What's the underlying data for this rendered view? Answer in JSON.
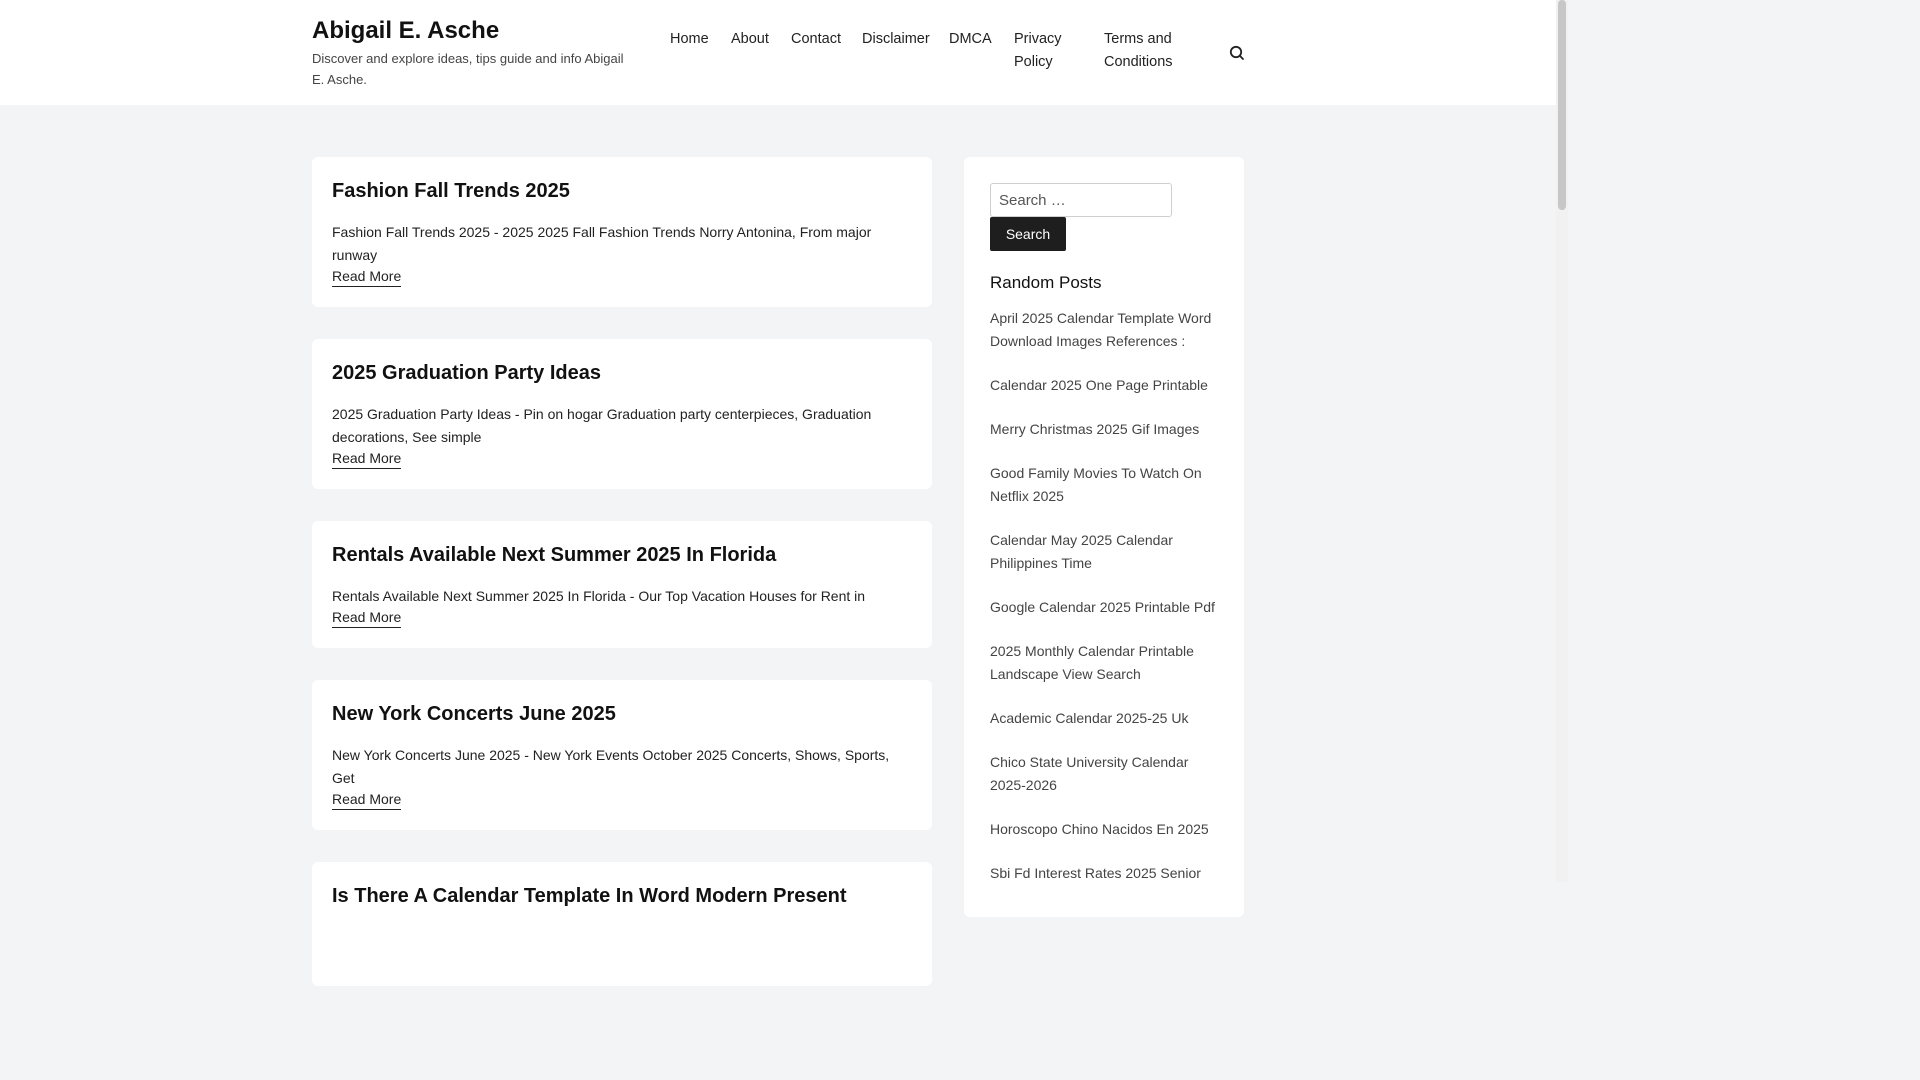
{
  "site": {
    "title": "Abigail E. Asche",
    "description": "Discover and explore ideas, tips guide and info Abigail E. Asche."
  },
  "nav": {
    "items": [
      {
        "label": "Home"
      },
      {
        "label": "About"
      },
      {
        "label": "Contact"
      },
      {
        "label": "Disclaimer"
      },
      {
        "label": "DMCA"
      },
      {
        "label": "Privacy Policy"
      },
      {
        "label": "Terms and Conditions"
      }
    ],
    "search_icon": "search-icon"
  },
  "posts": [
    {
      "title": "Fashion Fall Trends 2025",
      "excerpt": "Fashion Fall Trends 2025 - 2025 2025 Fall Fashion Trends Norry Antonina, From major runway",
      "read_more": "Read More"
    },
    {
      "title": "2025 Graduation Party Ideas",
      "excerpt": "2025 Graduation Party Ideas - Pin on hogar Graduation party centerpieces, Graduation decorations, See simple",
      "read_more": "Read More"
    },
    {
      "title": "Rentals Available Next Summer 2025 In Florida",
      "excerpt": "Rentals Available Next Summer 2025 In Florida - Our Top Vacation Houses for Rent in",
      "read_more": "Read More"
    },
    {
      "title": "New York Concerts June 2025",
      "excerpt": "New York Concerts June 2025 - New York Events October 2025 Concerts, Shows, Sports, Get",
      "read_more": "Read More"
    },
    {
      "title": "Is There A Calendar Template In Word Modern Present",
      "excerpt": "",
      "read_more": ""
    }
  ],
  "sidebar": {
    "search": {
      "placeholder": "Search …",
      "button_label": "Search"
    },
    "random_posts": {
      "title": "Random Posts",
      "items": [
        "April 2025 Calendar Template Word Download Images References :",
        "Calendar 2025 One Page Printable",
        "Merry Christmas 2025 Gif Images",
        "Good Family Movies To Watch On Netflix 2025",
        "Calendar May 2025 Calendar Philippines Time",
        "Google Calendar 2025 Printable Pdf",
        "2025 Monthly Calendar Printable Landscape View Search",
        "Academic Calendar 2025-25 Uk",
        "Chico State University Calendar 2025-2026",
        "Horoscopo Chino Nacidos En 2025",
        "Sbi Fd Interest Rates 2025 Senior"
      ]
    }
  }
}
